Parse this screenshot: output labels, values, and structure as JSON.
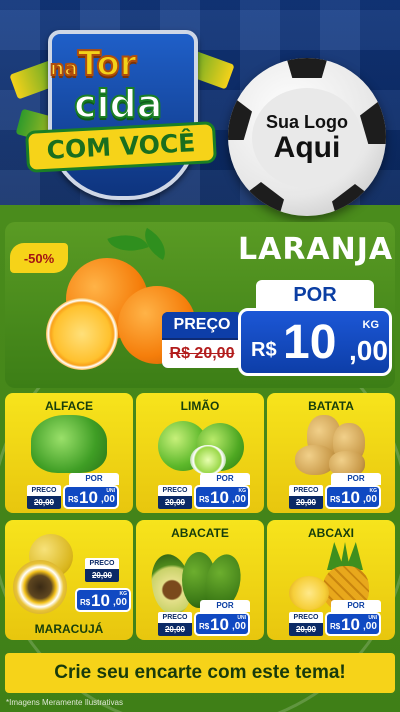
{
  "campaign": {
    "title_line_1_small": "na",
    "title_line_1": "Tor",
    "title_line_2": "cida",
    "title_line_3": "COM VOCÊ"
  },
  "logo_slot": {
    "line_1": "Sua Logo",
    "line_2": "Aqui"
  },
  "featured": {
    "discount": "-50%",
    "name": "LARANJA",
    "old_label": "PREÇO",
    "old_price": "R$ 20,00",
    "new_label": "POR",
    "currency": "R$",
    "price_int": "10",
    "price_dec": ",00",
    "unit": "KG"
  },
  "products": [
    {
      "name": "ALFACE",
      "old_label": "PRECO",
      "old_price": "20,00",
      "new_label": "POR",
      "currency": "R$",
      "price_int": "10",
      "price_dec": ",00",
      "unit": "UNI"
    },
    {
      "name": "LIMÃO",
      "old_label": "PRECO",
      "old_price": "20,00",
      "new_label": "POR",
      "currency": "R$",
      "price_int": "10",
      "price_dec": ",00",
      "unit": "KG"
    },
    {
      "name": "BATATA",
      "old_label": "PRECO",
      "old_price": "20,00",
      "new_label": "POR",
      "currency": "R$",
      "price_int": "10",
      "price_dec": ",00",
      "unit": "KG"
    },
    {
      "name": "MARACUJÁ",
      "old_label": "PRECO",
      "old_price": "20,00",
      "new_label": "POR",
      "currency": "R$",
      "price_int": "10",
      "price_dec": ",00",
      "unit": "KG"
    },
    {
      "name": "ABACATE",
      "old_label": "PRECO",
      "old_price": "20,00",
      "new_label": "POR",
      "currency": "R$",
      "price_int": "10",
      "price_dec": ",00",
      "unit": "UNI"
    },
    {
      "name": "ABCAXI",
      "old_label": "PRECO",
      "old_price": "20,00",
      "new_label": "POR",
      "currency": "R$",
      "price_int": "10",
      "price_dec": ",00",
      "unit": "UNI"
    }
  ],
  "cta": "Crie seu encarte com este tema!",
  "footer_note": "*Imagens Meramente Ilustrativas",
  "colors": {
    "field_green": "#4a8c1c",
    "header_blue": "#0b2a66",
    "card_yellow": "#f7e41c",
    "price_blue": "#1049c2",
    "old_price_red": "#b21c1c"
  }
}
